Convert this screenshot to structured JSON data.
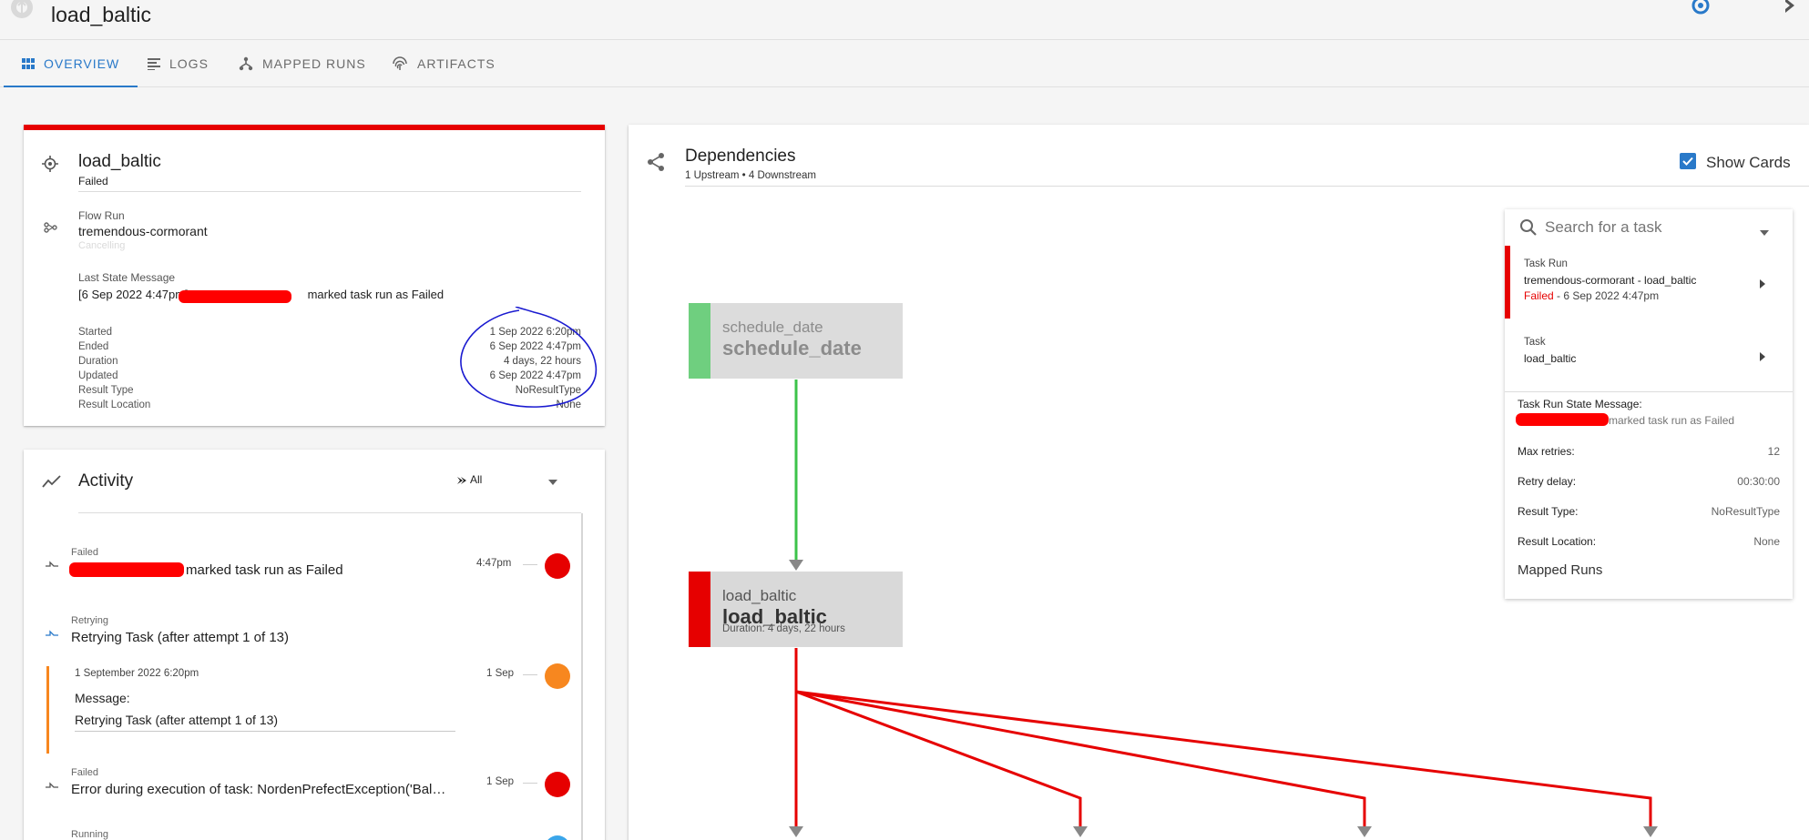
{
  "header": {
    "title": "load_baltic"
  },
  "tabs": [
    {
      "label": "OVERVIEW",
      "active": true
    },
    {
      "label": "LOGS",
      "active": false
    },
    {
      "label": "MAPPED RUNS",
      "active": false
    },
    {
      "label": "ARTIFACTS",
      "active": false
    }
  ],
  "task": {
    "name": "load_baltic",
    "state": "Failed",
    "flow_run_label": "Flow Run",
    "flow_run_name": "tremendous-cormorant",
    "flow_run_state": "Cancelling",
    "last_state_label": "Last State Message",
    "last_state_prefix": "[6 Sep 2022 4:47pm]:",
    "last_state_suffix": "marked task run as Failed",
    "meta": [
      {
        "label": "Started",
        "value": "1 Sep 2022 6:20pm"
      },
      {
        "label": "Ended",
        "value": "6 Sep 2022 4:47pm"
      },
      {
        "label": "Duration",
        "value": "4 days, 22 hours"
      },
      {
        "label": "Updated",
        "value": "6 Sep 2022 4:47pm"
      },
      {
        "label": "Result Type",
        "value": "NoResultType"
      },
      {
        "label": "Result Location",
        "value": "None"
      }
    ]
  },
  "activity": {
    "title": "Activity",
    "filter": "All",
    "items": [
      {
        "state": "Failed",
        "text": "marked task run as Failed",
        "time": "4:47pm"
      },
      {
        "state": "Retrying",
        "text": "Retrying Task (after attempt 1 of 13)",
        "time": ""
      },
      {
        "date": "1 September 2022 6:20pm",
        "message_label": "Message:",
        "message": "Retrying Task (after attempt 1 of 13)",
        "time": "1 Sep"
      },
      {
        "state": "Failed",
        "text": "Error during execution of task: NordenPrefectException('Bal…",
        "time": "1 Sep"
      },
      {
        "state": "Running",
        "text": "",
        "time": ""
      }
    ]
  },
  "dependencies": {
    "title": "Dependencies",
    "subtitle": "1 Upstream • 4 Downstream",
    "show_cards_label": "Show Cards",
    "show_cards_checked": true,
    "nodes": [
      {
        "sub": "schedule_date",
        "main": "schedule_date",
        "duration": ""
      },
      {
        "sub": "load_baltic",
        "main": "load_baltic",
        "duration": "Duration: 4 days, 22 hours"
      }
    ]
  },
  "side_panel": {
    "search_placeholder": "Search for a task",
    "task_run_label": "Task Run",
    "task_run_name": "tremendous-cormorant - load_baltic",
    "task_run_state": "Failed",
    "task_run_time": " - 6 Sep 2022 4:47pm",
    "task_label": "Task",
    "task_name": "load_baltic",
    "state_msg_label": "Task Run State Message:",
    "state_msg_text": "marked task run as Failed",
    "rows": [
      {
        "label": "Max retries:",
        "value": "12"
      },
      {
        "label": "Retry delay:",
        "value": "00:30:00"
      },
      {
        "label": "Result Type:",
        "value": "NoResultType"
      },
      {
        "label": "Result Location:",
        "value": "None"
      }
    ],
    "mapped_runs_label": "Mapped Runs"
  },
  "colors": {
    "failed": "#e60000",
    "success": "#6fcf7f",
    "retrying": "#f7871f",
    "running": "#3aa6ea",
    "accent": "#2979c9"
  },
  "icons": [
    "prefect-logo-icon",
    "grid-icon",
    "logs-icon",
    "fork-icon",
    "fingerprint-icon",
    "target-icon",
    "flow-icon",
    "trend-icon",
    "share-icon",
    "search-icon",
    "caret-down-icon",
    "chevron-right-icon",
    "checkbox-icon"
  ]
}
